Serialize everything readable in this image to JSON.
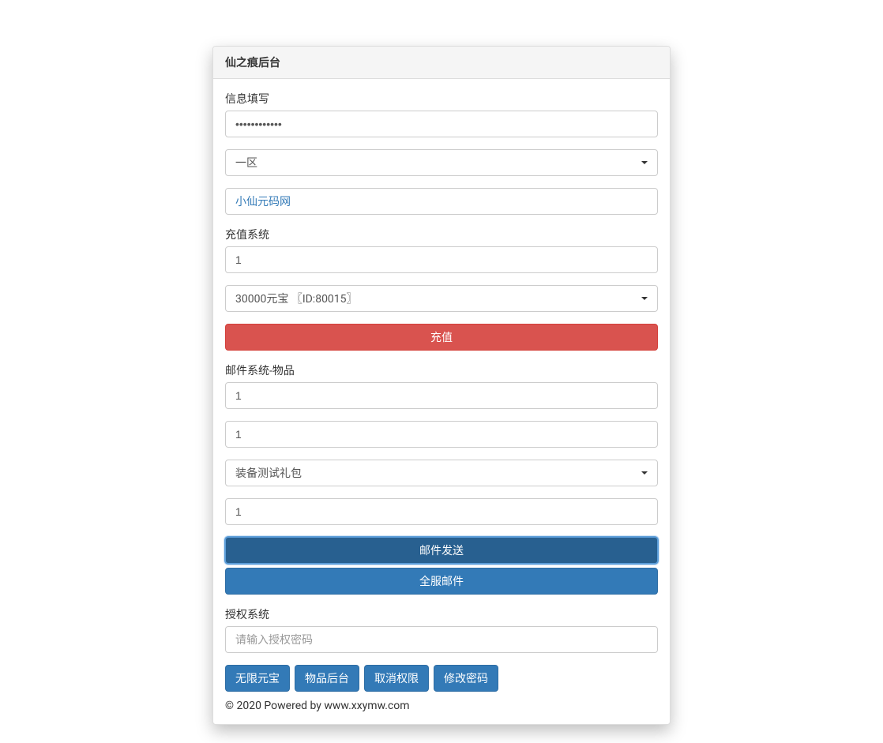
{
  "panel": {
    "title": "仙之痕后台"
  },
  "info": {
    "label": "信息填写",
    "password_value": "••••••••••••",
    "zone_selected": "一区",
    "name_value": "小仙元码网"
  },
  "recharge": {
    "label": "充值系统",
    "amount_value": "1",
    "item_selected": "30000元宝 〖ID:80015〗",
    "button": "充值"
  },
  "mail": {
    "label": "邮件系统-物品",
    "field1_value": "1",
    "field2_value": "1",
    "item_selected": "装备测试礼包",
    "field3_value": "1",
    "send_button": "邮件发送",
    "all_button": "全服邮件"
  },
  "auth": {
    "label": "授权系统",
    "placeholder": "请输入授权密码"
  },
  "actions": {
    "unlimited_gold": "无限元宝",
    "item_admin": "物品后台",
    "revoke": "取消权限",
    "change_password": "修改密码"
  },
  "footer": {
    "text": "© 2020 Powered by www.xxymw.com"
  }
}
